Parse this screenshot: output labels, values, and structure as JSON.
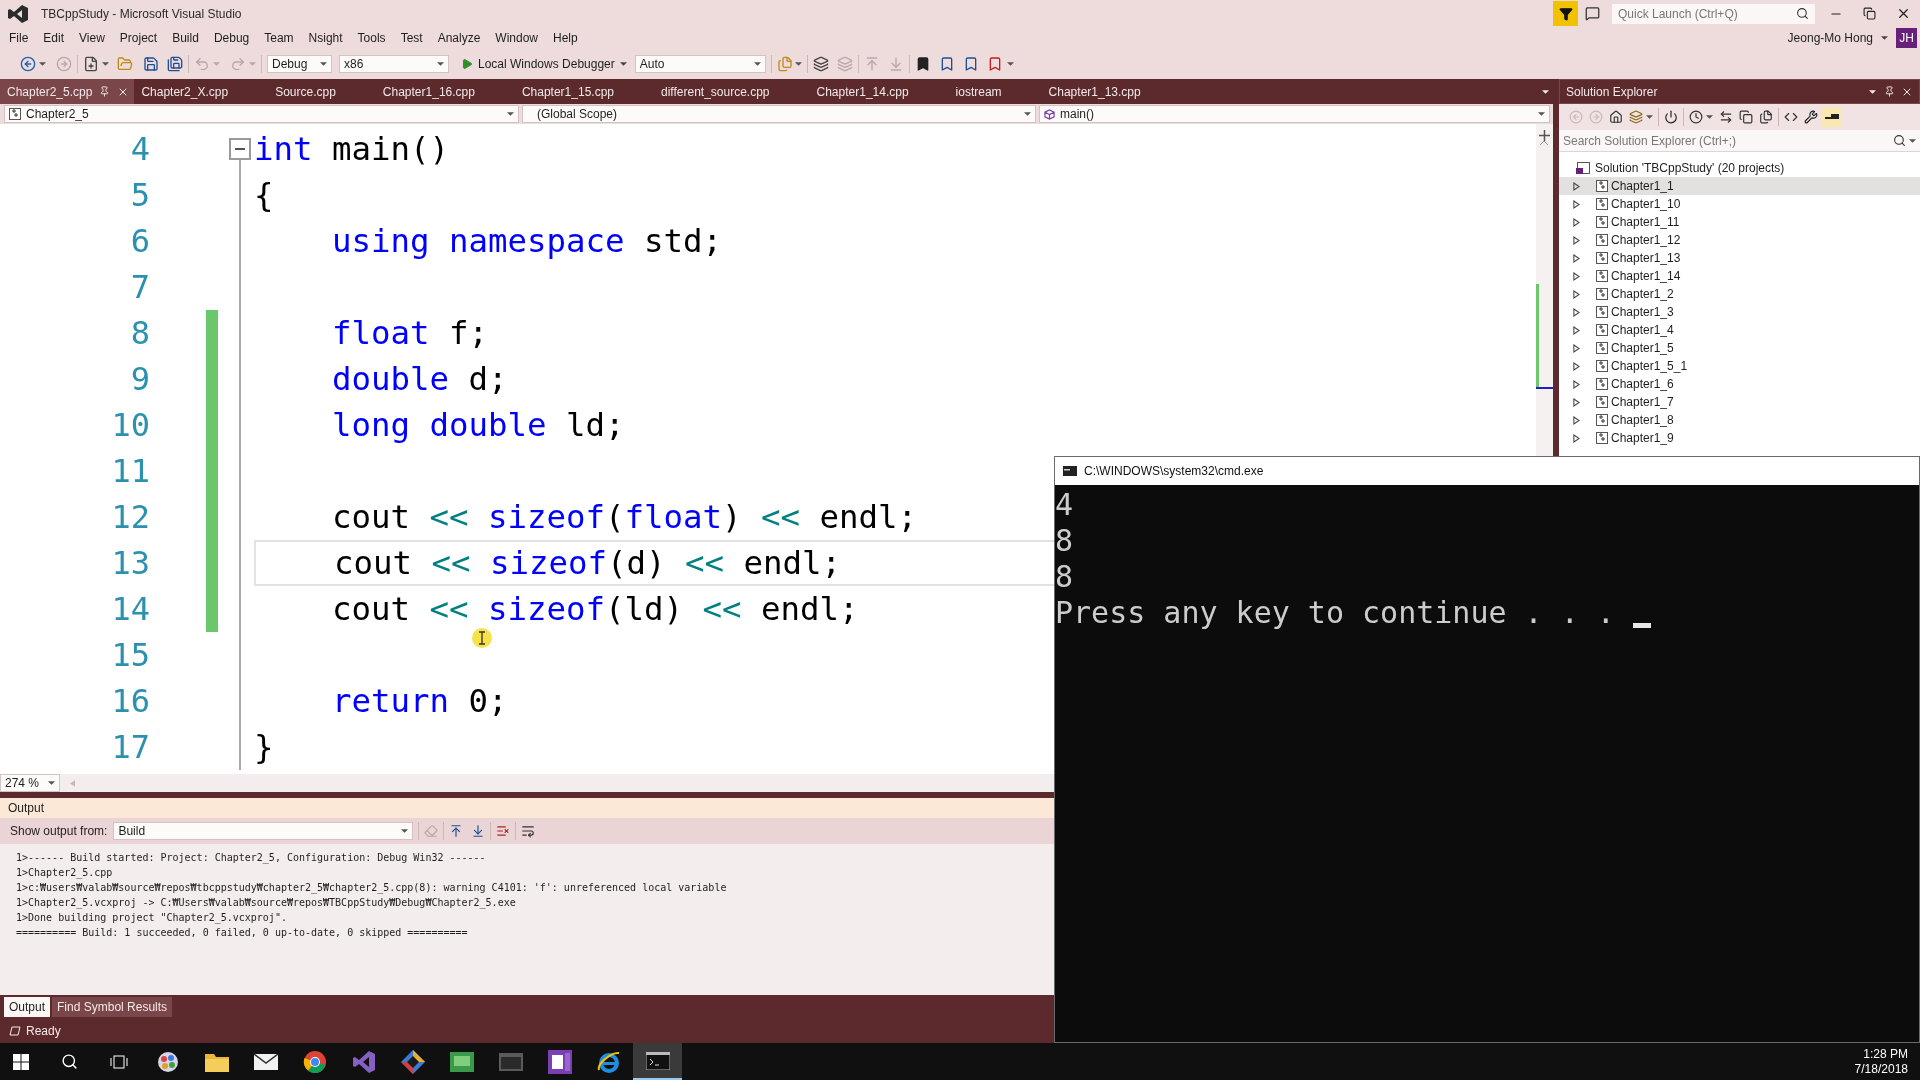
{
  "window": {
    "title": "TBCppStudy - Microsoft Visual Studio",
    "quick_launch": {
      "placeholder": "Quick Launch (Ctrl+Q)"
    },
    "user": {
      "name": "Jeong-Mo Hong",
      "initials": "JH"
    }
  },
  "menu": [
    "File",
    "Edit",
    "View",
    "Project",
    "Build",
    "Debug",
    "Team",
    "Nsight",
    "Tools",
    "Test",
    "Analyze",
    "Window",
    "Help"
  ],
  "toolbar": {
    "configuration": "Debug",
    "platform": "x86",
    "debugger": "Local Windows Debugger",
    "target": "Auto"
  },
  "tabs": [
    {
      "label": "Chapter2_5.cpp",
      "selected": true
    },
    {
      "label": "Chapter2_X.cpp",
      "selected": false
    },
    {
      "label": "Source.cpp",
      "selected": false
    },
    {
      "label": "Chapter1_16.cpp",
      "selected": false
    },
    {
      "label": "Chapter1_15.cpp",
      "selected": false
    },
    {
      "label": "different_source.cpp",
      "selected": false
    },
    {
      "label": "Chapter1_14.cpp",
      "selected": false
    },
    {
      "label": "iostream",
      "selected": false
    },
    {
      "label": "Chapter1_13.cpp",
      "selected": false
    }
  ],
  "navigation": {
    "project": "Chapter2_5",
    "scope": "(Global Scope)",
    "member": "main()"
  },
  "editor": {
    "zoom": "274 %",
    "lines": [
      {
        "number": "4",
        "changed": false,
        "current": false,
        "fold": {
          "expanded": true
        },
        "tokens": [
          {
            "kind": "keyword",
            "text": "int"
          },
          {
            "kind": "text",
            "text": " main()"
          }
        ]
      },
      {
        "number": "5",
        "changed": false,
        "current": false,
        "tokens": [
          {
            "kind": "text",
            "text": "{"
          }
        ],
        "children": [
          {
            "number": "6",
            "changed": false,
            "current": false,
            "tokens": [
              {
                "kind": "keyword",
                "text": "using namespace"
              },
              {
                "kind": "text",
                "text": " std;"
              }
            ]
          },
          {
            "number": "7",
            "changed": false,
            "current": false
          },
          {
            "number": "8",
            "changed": true,
            "current": false,
            "tokens": [
              {
                "kind": "keyword",
                "text": "float"
              },
              {
                "kind": "text",
                "text": " f;"
              }
            ]
          },
          {
            "number": "9",
            "changed": true,
            "current": false,
            "tokens": [
              {
                "kind": "keyword",
                "text": "double"
              },
              {
                "kind": "text",
                "text": " d;"
              }
            ]
          },
          {
            "number": "10",
            "changed": true,
            "current": false,
            "tokens": [
              {
                "kind": "keyword",
                "text": "long double"
              },
              {
                "kind": "text",
                "text": " ld;"
              }
            ]
          },
          {
            "number": "11",
            "changed": true,
            "current": false
          },
          {
            "number": "12",
            "changed": true,
            "current": false,
            "tokens": [
              {
                "kind": "text",
                "text": "cout "
              },
              {
                "kind": "operator",
                "text": "<<"
              },
              {
                "kind": "keyword",
                "text": " sizeof"
              },
              {
                "kind": "text",
                "text": "("
              },
              {
                "kind": "keyword",
                "text": "float"
              },
              {
                "kind": "text",
                "text": ") "
              },
              {
                "kind": "operator",
                "text": "<<"
              },
              {
                "kind": "text",
                "text": " endl;"
              }
            ]
          },
          {
            "number": "13",
            "changed": true,
            "current": true,
            "tokens": [
              {
                "kind": "text",
                "text": "cout "
              },
              {
                "kind": "operator",
                "text": "<<"
              },
              {
                "kind": "keyword",
                "text": " sizeof"
              },
              {
                "kind": "text",
                "text": "(d) "
              },
              {
                "kind": "operator",
                "text": "<<"
              },
              {
                "kind": "text",
                "text": " endl;"
              }
            ]
          },
          {
            "number": "14",
            "changed": true,
            "current": false,
            "tokens": [
              {
                "kind": "text",
                "text": "cout "
              },
              {
                "kind": "operator",
                "text": "<<"
              },
              {
                "kind": "keyword",
                "text": " sizeof"
              },
              {
                "kind": "text",
                "text": "(ld) "
              },
              {
                "kind": "operator",
                "text": "<<"
              },
              {
                "kind": "text",
                "text": " endl;"
              }
            ]
          },
          {
            "number": "15",
            "changed": false,
            "current": false
          },
          {
            "number": "16",
            "changed": false,
            "current": false,
            "tokens": [
              {
                "kind": "keyword",
                "text": "return"
              },
              {
                "kind": "text",
                "text": " 0;"
              }
            ]
          }
        ]
      },
      {
        "number": "17",
        "changed": false,
        "current": false,
        "tokens": [
          {
            "kind": "text",
            "text": "}"
          }
        ]
      }
    ]
  },
  "solution_explorer": {
    "title": "Solution Explorer",
    "search": {
      "placeholder": "Search Solution Explorer (Ctrl+;)"
    },
    "tree": [
      {
        "kind": "solution",
        "label": "Solution 'TBCppStudy' (20 projects)",
        "selected": false,
        "children": [
          {
            "kind": "project",
            "label": "Chapter1_1",
            "expanded": false,
            "selected": true
          },
          {
            "kind": "project",
            "label": "Chapter1_10",
            "expanded": false,
            "selected": false
          },
          {
            "kind": "project",
            "label": "Chapter1_11",
            "expanded": false,
            "selected": false
          },
          {
            "kind": "project",
            "label": "Chapter1_12",
            "expanded": false,
            "selected": false
          },
          {
            "kind": "project",
            "label": "Chapter1_13",
            "expanded": false,
            "selected": false
          },
          {
            "kind": "project",
            "label": "Chapter1_14",
            "expanded": false,
            "selected": false
          },
          {
            "kind": "project",
            "label": "Chapter1_2",
            "expanded": false,
            "selected": false
          },
          {
            "kind": "project",
            "label": "Chapter1_3",
            "expanded": false,
            "selected": false
          },
          {
            "kind": "project",
            "label": "Chapter1_4",
            "expanded": false,
            "selected": false
          },
          {
            "kind": "project",
            "label": "Chapter1_5",
            "expanded": false,
            "selected": false
          },
          {
            "kind": "project",
            "label": "Chapter1_5_1",
            "expanded": false,
            "selected": false
          },
          {
            "kind": "project",
            "label": "Chapter1_6",
            "expanded": false,
            "selected": false
          },
          {
            "kind": "project",
            "label": "Chapter1_7",
            "expanded": false,
            "selected": false
          },
          {
            "kind": "project",
            "label": "Chapter1_8",
            "expanded": false,
            "selected": false
          },
          {
            "kind": "project",
            "label": "Chapter1_9",
            "expanded": false,
            "selected": false
          }
        ]
      }
    ]
  },
  "output": {
    "title": "Output",
    "source_label": "Show output from:",
    "source": "Build",
    "lines": [
      "1>------ Build started: Project: Chapter2_5, Configuration: Debug Win32 ------",
      "1>Chapter2_5.cpp",
      "1>c:₩users₩valab₩source₩repos₩tbcppstudy₩chapter2_5₩chapter2_5.cpp(8): warning C4101: 'f': unreferenced local variable",
      "1>Chapter2_5.vcxproj -> C:₩Users₩valab₩source₩repos₩TBCppStudy₩Debug₩Chapter2_5.exe",
      "1>Done building project \"Chapter2_5.vcxproj\".",
      "========== Build: 1 succeeded, 0 failed, 0 up-to-date, 0 skipped =========="
    ],
    "tabs": [
      {
        "label": "Output",
        "selected": true
      },
      {
        "label": "Find Symbol Results",
        "selected": false
      }
    ]
  },
  "status_bar": {
    "text": "Ready"
  },
  "console": {
    "title": "C:\\WINDOWS\\system32\\cmd.exe",
    "lines": [
      "4",
      "8",
      "8",
      "Press any key to continue . . ."
    ]
  },
  "taskbar": {
    "apps": [
      {
        "kind": "palette",
        "active": false
      },
      {
        "kind": "folder",
        "active": false
      },
      {
        "kind": "mail",
        "active": false
      },
      {
        "kind": "ball",
        "active": false
      },
      {
        "kind": "ide",
        "active": false
      },
      {
        "kind": "diamond",
        "active": false
      },
      {
        "kind": "board",
        "active": false
      },
      {
        "kind": "window",
        "active": false
      },
      {
        "kind": "notebook",
        "active": false
      },
      {
        "kind": "ebrowser",
        "active": false
      },
      {
        "kind": "terminal",
        "active": true
      }
    ],
    "time": "1:28 PM",
    "date": "7/18/2018"
  }
}
